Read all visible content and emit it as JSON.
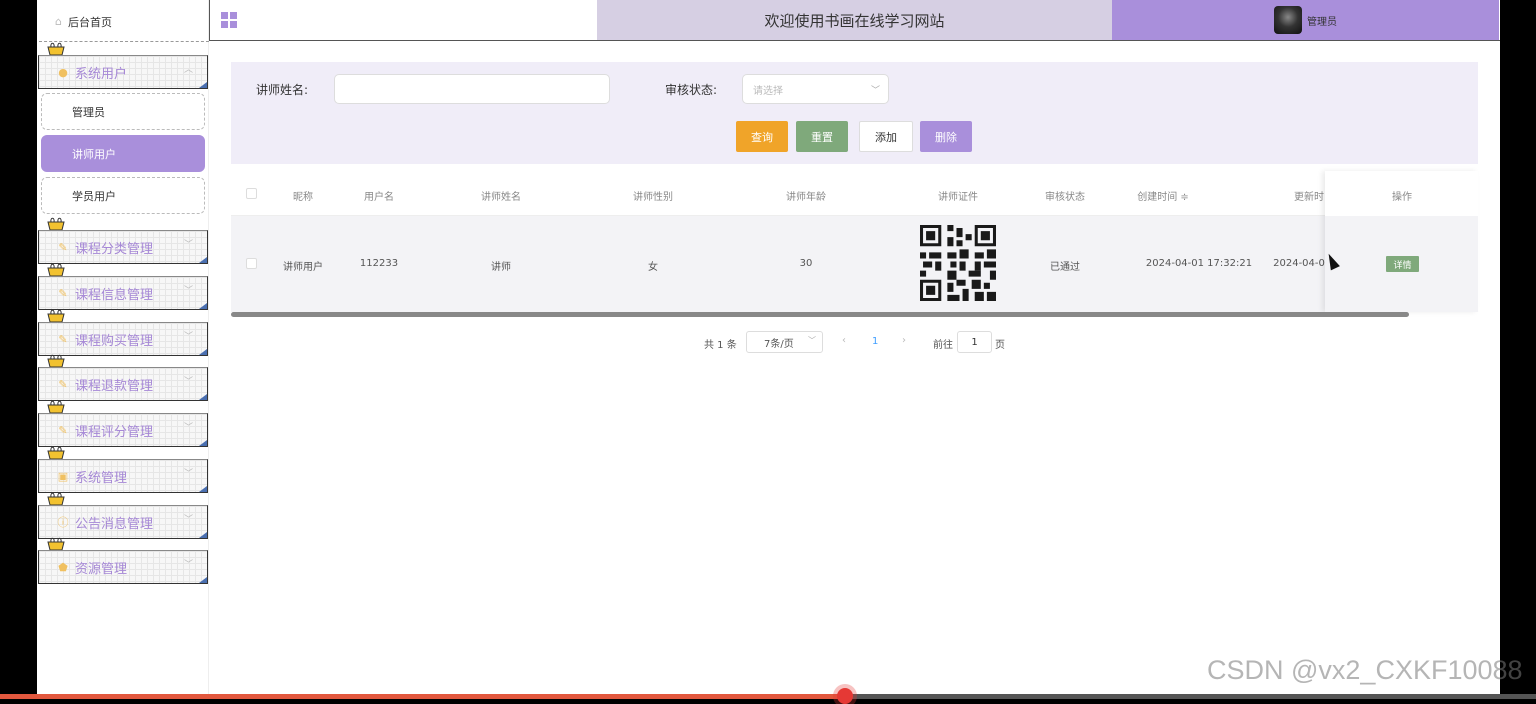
{
  "sidebar": {
    "home_label": "后台首页",
    "menus": [
      {
        "label": "系统用户",
        "icon": "user-icon",
        "children": [
          "管理员",
          "讲师用户",
          "学员用户"
        ],
        "active_child": 1
      },
      {
        "label": "课程分类管理",
        "icon": "edit-icon"
      },
      {
        "label": "课程信息管理",
        "icon": "edit-icon"
      },
      {
        "label": "课程购买管理",
        "icon": "edit-icon"
      },
      {
        "label": "课程退款管理",
        "icon": "edit-icon"
      },
      {
        "label": "课程评分管理",
        "icon": "edit-icon"
      },
      {
        "label": "系统管理",
        "icon": "image-icon"
      },
      {
        "label": "公告消息管理",
        "icon": "info-icon"
      },
      {
        "label": "资源管理",
        "icon": "shield-icon"
      }
    ]
  },
  "header": {
    "site_title": "欢迎使用书画在线学习网站",
    "user_name": "管理员"
  },
  "search": {
    "name_label": "讲师姓名:",
    "name_value": "",
    "status_label": "审核状态:",
    "status_placeholder": "请选择",
    "buttons": {
      "query": "查询",
      "reset": "重置",
      "add": "添加",
      "delete": "删除"
    }
  },
  "table": {
    "columns": [
      "昵称",
      "用户名",
      "讲师姓名",
      "讲师性别",
      "讲师年龄",
      "讲师证件",
      "审核状态",
      "创建时间",
      "更新时",
      "操作"
    ],
    "sort_indicator": "≑",
    "rows": [
      {
        "nickname": "讲师用户",
        "username": "112233",
        "teacher_name": "讲师",
        "gender": "女",
        "age": "30",
        "certificate": "qr-code-image",
        "status": "已通过",
        "created": "2024-04-01 17:32:21",
        "updated": "2024-04-0",
        "action": "详情"
      }
    ]
  },
  "pagination": {
    "total_text": "共 1 条",
    "page_size": "7条/页",
    "current_page": "1",
    "goto_label": "前往",
    "goto_value": "1",
    "page_suffix": "页"
  },
  "watermark": "CSDN @vx2_CXKF10088",
  "video_progress": 0.55,
  "colors": {
    "accent": "#a98fdb",
    "query": "#f0a429",
    "reset": "#7fa97b",
    "delete": "#a98fdb",
    "title_bar": "#d6cfe3"
  }
}
